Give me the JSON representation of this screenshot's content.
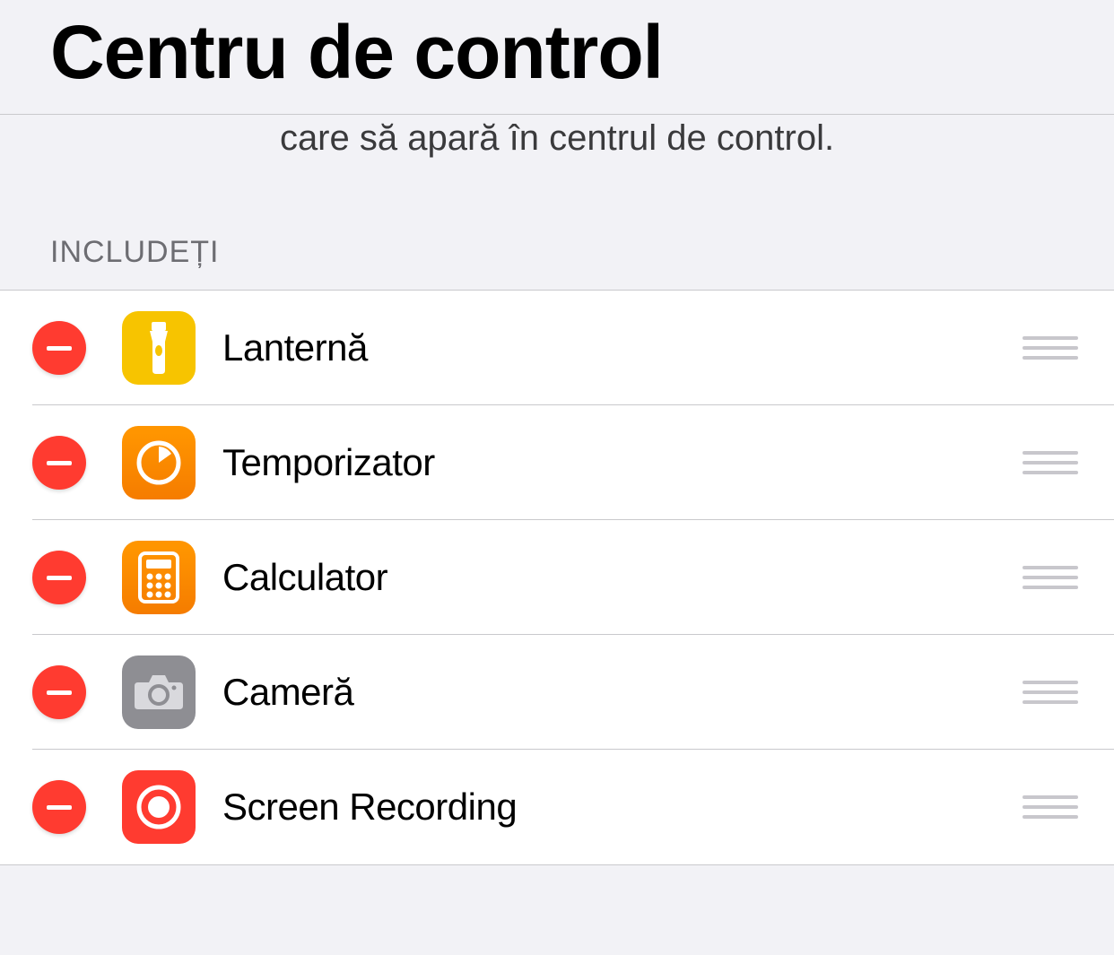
{
  "header": {
    "title": "Centru de control"
  },
  "description": "care să apară în centrul de control.",
  "section_label": "INCLUDEȚI",
  "items": [
    {
      "label": "Lanternă",
      "icon": "flashlight-icon",
      "icon_class": "icon-flashlight"
    },
    {
      "label": "Temporizator",
      "icon": "timer-icon",
      "icon_class": "icon-timer"
    },
    {
      "label": "Calculator",
      "icon": "calculator-icon",
      "icon_class": "icon-calculator"
    },
    {
      "label": "Cameră",
      "icon": "camera-icon",
      "icon_class": "icon-camera"
    },
    {
      "label": "Screen Recording",
      "icon": "screen-recording-icon",
      "icon_class": "icon-screenrec"
    }
  ]
}
